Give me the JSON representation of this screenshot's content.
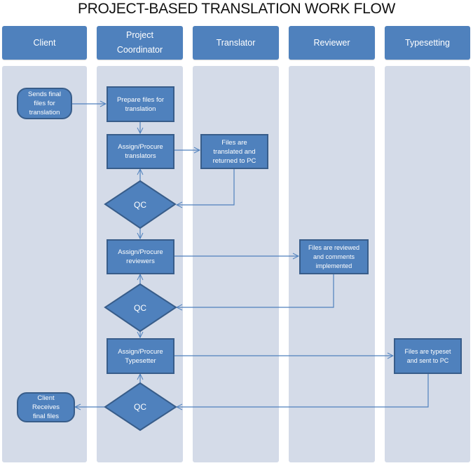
{
  "title": "PROJECT-BASED TRANSLATION WORK FLOW",
  "colors": {
    "shape_fill": "#4f81bd",
    "shape_border": "#385d8a",
    "lane_fill": "#d4dbe8",
    "connector": "#4f81bd",
    "text_on_shape": "#ffffff"
  },
  "lanes": [
    {
      "label": "Client"
    },
    {
      "label": "Project Coordinator"
    },
    {
      "label": "Translator"
    },
    {
      "label": "Reviewer"
    },
    {
      "label": "Typesetting"
    }
  ],
  "nodes": {
    "client_sends": {
      "label": "Sends final files for translation",
      "shape": "terminator",
      "lane": "Client"
    },
    "prepare_files": {
      "label": "Prepare files for translation",
      "shape": "process",
      "lane": "Project Coordinator"
    },
    "assign_translators": {
      "label": "Assign/Procure translators",
      "shape": "process",
      "lane": "Project Coordinator"
    },
    "translated": {
      "label": "Files are translated and returned to PC",
      "shape": "process",
      "lane": "Translator"
    },
    "qc1": {
      "label": "QC",
      "shape": "decision",
      "lane": "Project Coordinator"
    },
    "assign_reviewers": {
      "label": "Assign/Procure reviewers",
      "shape": "process",
      "lane": "Project Coordinator"
    },
    "reviewed": {
      "label": "Files are reviewed and comments implemented",
      "shape": "process",
      "lane": "Reviewer"
    },
    "qc2": {
      "label": "QC",
      "shape": "decision",
      "lane": "Project Coordinator"
    },
    "assign_typesetter": {
      "label": "Assign/Procure Typesetter",
      "shape": "process",
      "lane": "Project Coordinator"
    },
    "typeset": {
      "label": "Files are  typeset and sent to PC",
      "shape": "process",
      "lane": "Typesetting"
    },
    "qc3": {
      "label": "QC",
      "shape": "decision",
      "lane": "Project Coordinator"
    },
    "client_receives": {
      "label": "Client Receives final files",
      "shape": "terminator",
      "lane": "Client"
    }
  },
  "edges": [
    {
      "from": "client_sends",
      "to": "prepare_files"
    },
    {
      "from": "prepare_files",
      "to": "assign_translators"
    },
    {
      "from": "assign_translators",
      "to": "translated"
    },
    {
      "from": "translated",
      "to": "qc1"
    },
    {
      "from": "qc1",
      "to": "assign_translators"
    },
    {
      "from": "qc1",
      "to": "assign_reviewers"
    },
    {
      "from": "assign_reviewers",
      "to": "reviewed"
    },
    {
      "from": "reviewed",
      "to": "qc2"
    },
    {
      "from": "qc2",
      "to": "assign_reviewers"
    },
    {
      "from": "qc2",
      "to": "assign_typesetter"
    },
    {
      "from": "assign_typesetter",
      "to": "typeset"
    },
    {
      "from": "typeset",
      "to": "qc3"
    },
    {
      "from": "qc3",
      "to": "assign_typesetter"
    },
    {
      "from": "qc3",
      "to": "client_receives"
    }
  ]
}
